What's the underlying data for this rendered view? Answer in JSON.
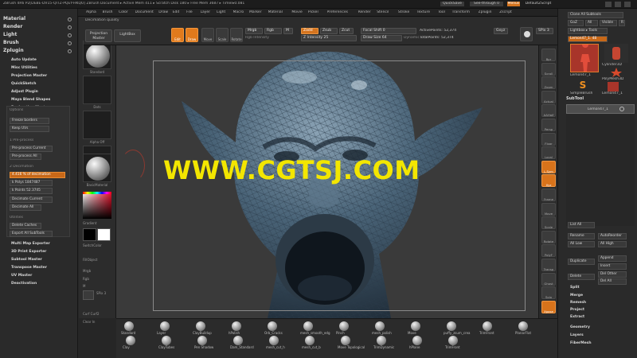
{
  "titlebar": {
    "title": "ZBrush 4R6 P2[DEBE-DV15-QITZ-PQEY-HKQU]   ZBrush Document    ▸ Active Mem 411 ▸ Scratch Disk 180 ▸ Free Mem 3687 ▸ Timer▸0.081",
    "quicksave": "QuickSave",
    "see_through": "See-through 0",
    "menus_label": "Menus",
    "default_script": "DefaultZScript"
  },
  "menubar": {
    "items": [
      "Alpha",
      "Brush",
      "Color",
      "Document",
      "Draw",
      "Edit",
      "File",
      "Layer",
      "Light",
      "Macro",
      "Marker",
      "Material",
      "Movie",
      "Picker",
      "Preferences",
      "Render",
      "Stencil",
      "Stroke",
      "Texture",
      "Tool",
      "Transform",
      "Zplugin",
      "Zscript"
    ]
  },
  "toolbar": {
    "label": "Decimation quality",
    "projection_master": "Projection Master",
    "lightbox": "LightBox",
    "edit": "Edit",
    "draw": "Draw",
    "move": "Move",
    "scale": "Scale",
    "rotate": "Rotate",
    "mrgb": "Mrgb",
    "rgb": "Rgb",
    "m": "M",
    "rgb_intensity": "Rgb Intensity",
    "zadd": "Zadd",
    "zsub": "Zsub",
    "zcut": "Zcut",
    "z_intensity": "Z Intensity 25",
    "focal_shift": "Focal Shift 0",
    "draw_size": "Draw Size 64",
    "dynamic": "Dynamic",
    "active_points": "ActivePoints: 52,374",
    "total_points": "TotalPoints: 52,374",
    "gxyz": "Gxyz",
    "spix": "SPix 3"
  },
  "left_panel": {
    "headers": [
      "Material",
      "Render",
      "Light",
      "Brush",
      "Zplugin"
    ],
    "zplugin_items": [
      "Auto Update",
      "Misc Utilities",
      "Projection Master",
      "QuickSketch",
      "Adjust Plugin",
      "Maya Blend Shapes",
      "Decimation Master"
    ],
    "decimation": {
      "options_label": "Options",
      "freeze_borders": "Freeze borders",
      "keep_uvs": "Keep UVs",
      "preprocess_label": "1 Pre-process",
      "preprocess_current": "Pre-process Current",
      "preprocess_all": "Pre-process All",
      "decimation_label": "2 Decimation",
      "percent": "4.416 % of decimation",
      "polys": "k Polys 1847487",
      "points": "k Points 52.3745",
      "decimate_current": "Decimate Current",
      "decimate_all": "Decimate All",
      "utilities_label": "Utilities",
      "delete_caches": "Delete Caches",
      "export_all": "Export All SubTools"
    },
    "more_items": [
      "Multi Map Exporter",
      "3D Print Exporter",
      "Subtool Master",
      "Transpose Master",
      "UV Master",
      "Deactivation"
    ]
  },
  "shelf": {
    "labels": [
      "Standard",
      "Dots",
      "Alpha Off",
      "Texture Off",
      "BasicMaterial",
      "Gradient",
      "SwitchColor",
      "FillObject",
      "Mrgb",
      "Rgb",
      "M",
      "SPix 3",
      "Curf Curf2",
      "Clear In"
    ]
  },
  "right_strip": {
    "labels": [
      "Bpr",
      "Scroll",
      "Zoom",
      "Actual",
      "AAHalf",
      "Persp",
      "Floor",
      "Local",
      "L.Sym",
      "Xyz",
      "Frame",
      "Move",
      "Scale",
      "Rotate",
      "PolyF",
      "Transp",
      "Ghost",
      "Solo",
      "Xpose"
    ]
  },
  "right_panel": {
    "clone": "Clone All Subtools",
    "goz": "GoZ",
    "all": "All",
    "visible": "Visible",
    "r": "R",
    "lightbox_tools": "Lightbox ▸ Tools",
    "lemon": "Lemon47_1. 48",
    "tool_names": [
      "Lemon47_1",
      "Cylinder3D",
      "PolyMesh3D",
      "SimpleBrush",
      "Lemon47_1"
    ],
    "subtool": "SubTool",
    "subtool_item": "Lemon47_1",
    "list_all": "List All",
    "rename": "Rename",
    "autoreorder": "AutoReorder",
    "all_low": "All Low",
    "all_high": "All High",
    "duplicate": "Duplicate",
    "append": "Append",
    "insert": "Insert",
    "delete": "Delete",
    "del_other": "Del Other",
    "del_all": "Del All",
    "split": "Split",
    "merge": "Merge",
    "remesh": "Remesh",
    "project": "Project",
    "extract": "Extract",
    "geometry": "Geometry",
    "layers": "Layers",
    "fibermesh": "FiberMesh"
  },
  "bottom_shelf": {
    "brushes": [
      {
        "name": "Standard"
      },
      {
        "name": "Layer"
      },
      {
        "name": "ClayBuildup"
      },
      {
        "name": "hPolish"
      },
      {
        "name": "Orb_Cracks"
      },
      {
        "name": "mesh_smooth_edg"
      },
      {
        "name": "Pinch"
      },
      {
        "name": "mesh_polish"
      },
      {
        "name": "Move"
      },
      {
        "name": "puffy_zsum_crea"
      },
      {
        "name": "TrimFront"
      },
      {
        "name": "PlanarFlat"
      },
      {
        "name": "Clay"
      },
      {
        "name": "ClayTubes"
      },
      {
        "name": "Pen Shadow"
      },
      {
        "name": "Dam_Standard"
      },
      {
        "name": "mesh_cut_h"
      },
      {
        "name": "mesh_cut_b"
      },
      {
        "name": "Move Topological"
      },
      {
        "name": "TrimDynamic"
      },
      {
        "name": "hPlane"
      },
      {
        "name": "TrimFront"
      }
    ]
  },
  "watermark": "WWW.CGTSJ.COM",
  "colors": {
    "accent": "#e07a1c",
    "model": "#4a6478",
    "watermark": "#f3e600"
  }
}
